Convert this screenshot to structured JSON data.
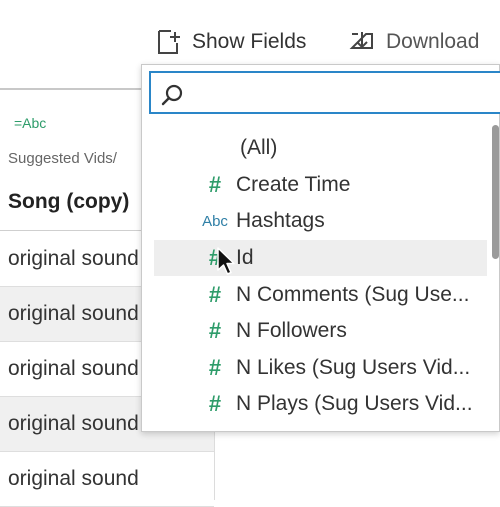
{
  "toolbar": {
    "show_fields_label": "Show Fields",
    "download_label": "Download"
  },
  "grid": {
    "column": {
      "type_badge": "=Abc",
      "source_label": "Suggested Vids/",
      "title": "Song (copy)"
    },
    "rows": [
      "original sound",
      "original sound",
      "original sound",
      "original sound",
      "original sound"
    ]
  },
  "dropdown": {
    "search": {
      "value": "",
      "placeholder": ""
    },
    "items": [
      {
        "icon": "",
        "label": "(All)"
      },
      {
        "icon": "number-icon",
        "label": "Create Time"
      },
      {
        "icon": "string-icon",
        "label": "Hashtags"
      },
      {
        "icon": "number-icon",
        "label": "Id"
      },
      {
        "icon": "number-icon",
        "label": "N Comments (Sug Use..."
      },
      {
        "icon": "number-icon",
        "label": "N Followers"
      },
      {
        "icon": "number-icon",
        "label": "N Likes (Sug Users Vid..."
      },
      {
        "icon": "number-icon",
        "label": "N Plays (Sug Users Vid..."
      }
    ],
    "icon_text": {
      "hash": "#",
      "abc": "Abc"
    }
  },
  "colors": {
    "accent": "#2a86c8",
    "number_icon": "#2e9c6a",
    "string_icon": "#2f7fa6",
    "hover_row": "#eeeeee",
    "alt_row": "#f0f0f0"
  }
}
